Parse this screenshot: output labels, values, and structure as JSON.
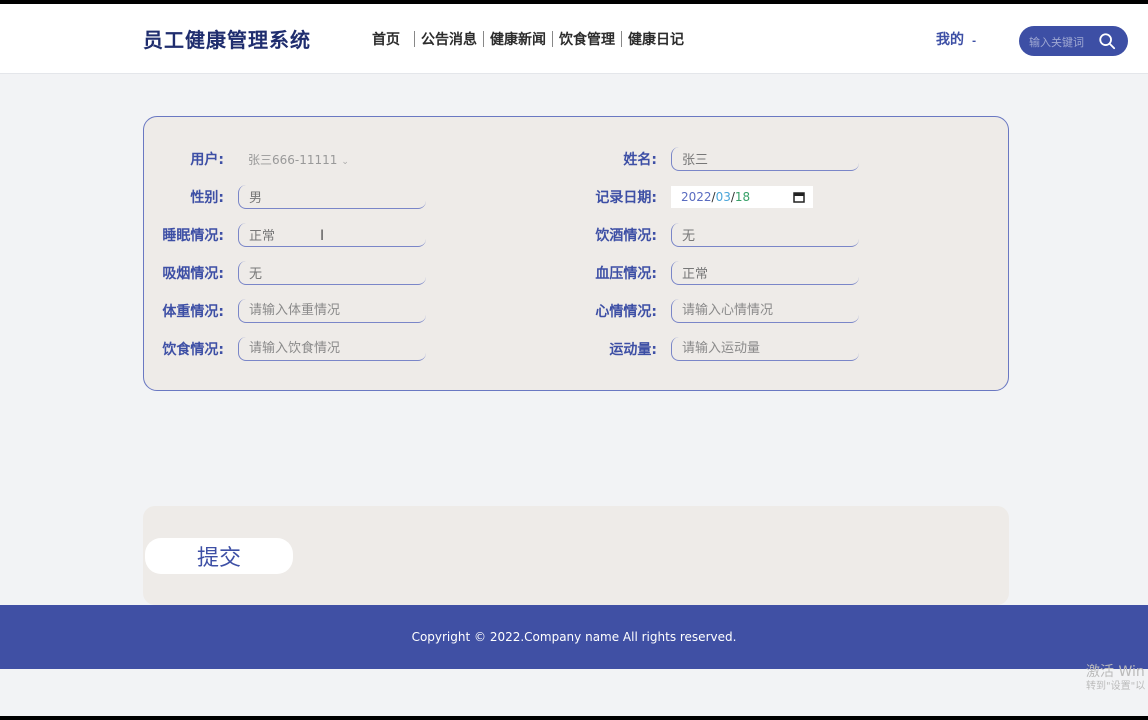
{
  "header": {
    "brand": "员工健康管理系统",
    "nav": [
      "首页",
      "公告消息",
      "健康新闻",
      "饮食管理",
      "健康日记"
    ],
    "mine": "我的",
    "search_placeholder": "输入关键词"
  },
  "form": {
    "user": {
      "label": "用户:",
      "value": "张三666-11111"
    },
    "name": {
      "label": "姓名:",
      "value": "张三"
    },
    "gender": {
      "label": "性别:",
      "value": "男"
    },
    "record_date": {
      "label": "记录日期:",
      "year": "2022",
      "month": "03",
      "day": "18"
    },
    "sleep": {
      "label": "睡眠情况:",
      "value": "正常"
    },
    "drinking": {
      "label": "饮酒情况:",
      "value": "无"
    },
    "smoking": {
      "label": "吸烟情况:",
      "value": "无"
    },
    "blood_pressure": {
      "label": "血压情况:",
      "value": "正常"
    },
    "weight": {
      "label": "体重情况:",
      "placeholder": "请输入体重情况"
    },
    "mood": {
      "label": "心情情况:",
      "placeholder": "请输入心情情况"
    },
    "diet": {
      "label": "饮食情况:",
      "placeholder": "请输入饮食情况"
    },
    "exercise": {
      "label": "运动量:",
      "placeholder": "请输入运动量"
    }
  },
  "submit_label": "提交",
  "footer_text": "Copyright © 2022.Company name All rights reserved.",
  "watermark": {
    "line1": "激活 Win",
    "line2": "转到\"设置\"以"
  },
  "colors": {
    "primary": "#3d4fa5",
    "card_bg": "#eeebe8",
    "footer_bg": "#4050a4"
  }
}
